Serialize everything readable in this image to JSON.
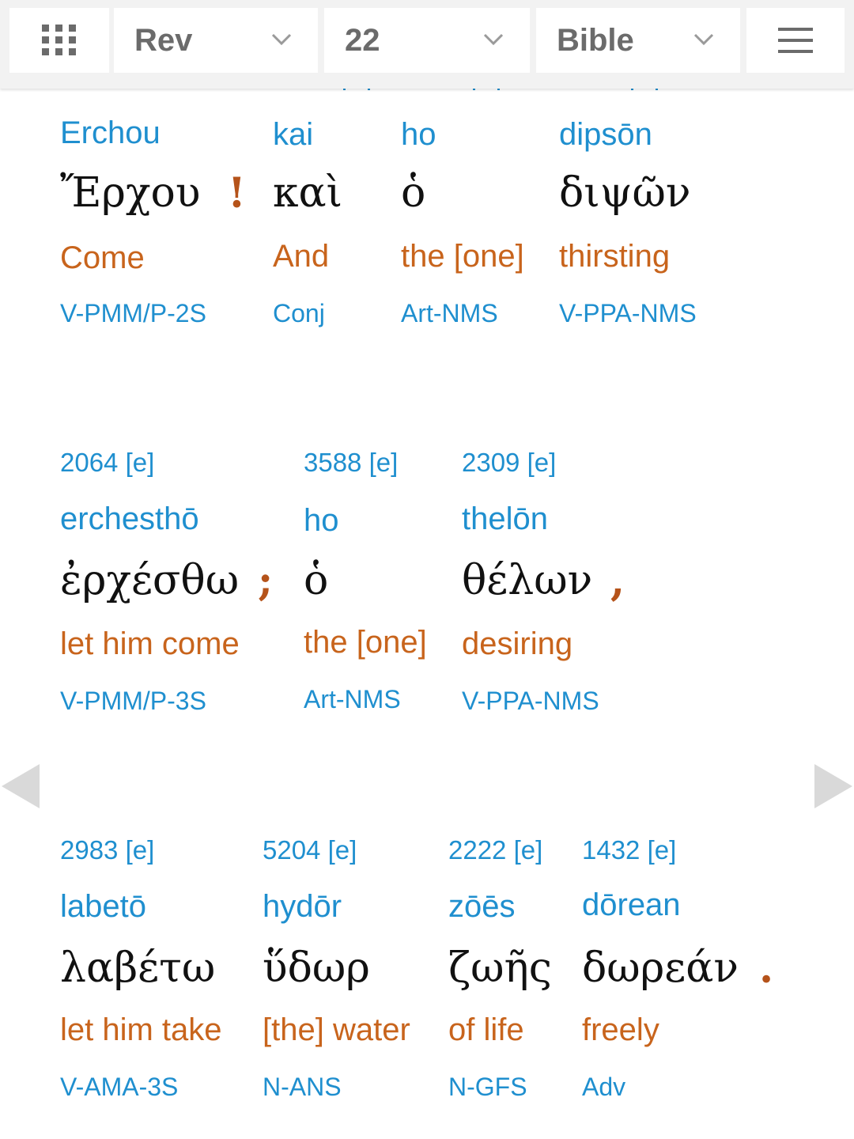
{
  "toolbar": {
    "book": "Rev",
    "chapter": "22",
    "version": "Bible"
  },
  "colors": {
    "link_blue": "#1f8fcf",
    "english_orange": "#c8641c",
    "punctuation": "#b5531a",
    "greek": "#111111"
  },
  "words": [
    {
      "translit": "Erchou",
      "greek": "Ἔρχου",
      "english": "Come",
      "parse": "V-PMM/P-2S",
      "punct": "!"
    },
    {
      "translit": "kai",
      "greek": "καὶ",
      "english": "And",
      "parse": "Conj"
    },
    {
      "translit": "ho",
      "greek": "ὁ",
      "english": "the [one]",
      "parse": "Art-NMS"
    },
    {
      "translit": "dipsōn",
      "greek": "διψῶν",
      "english": "thirsting",
      "parse": "V-PPA-NMS"
    },
    {
      "strongs": "2064",
      "strongs_link": "[e]",
      "translit": "erchesthō",
      "greek": "ἐρχέσθω",
      "english": "let him come",
      "parse": "V-PMM/P-3S",
      "punct": ";"
    },
    {
      "strongs": "3588",
      "strongs_link": "[e]",
      "translit": "ho",
      "greek": "ὁ",
      "english": "the [one]",
      "parse": "Art-NMS"
    },
    {
      "strongs": "2309",
      "strongs_link": "[e]",
      "translit": "thelōn",
      "greek": "θέλων",
      "english": "desiring",
      "parse": "V-PPA-NMS",
      "punct": ","
    },
    {
      "strongs": "2983",
      "strongs_link": "[e]",
      "translit": "labetō",
      "greek": "λαβέτω",
      "english": "let him take",
      "parse": "V-AMA-3S"
    },
    {
      "strongs": "5204",
      "strongs_link": "[e]",
      "translit": "hydōr",
      "greek": "ὕδωρ",
      "english": "[the] water",
      "parse": "N-ANS"
    },
    {
      "strongs": "2222",
      "strongs_link": "[e]",
      "translit": "zōēs",
      "greek": "ζωῆς",
      "english": "of life",
      "parse": "N-GFS"
    },
    {
      "strongs": "1432",
      "strongs_link": "[e]",
      "translit": "dōrean",
      "greek": "δωρεάν",
      "english": "freely",
      "parse": "Adv",
      "punct": "."
    }
  ]
}
